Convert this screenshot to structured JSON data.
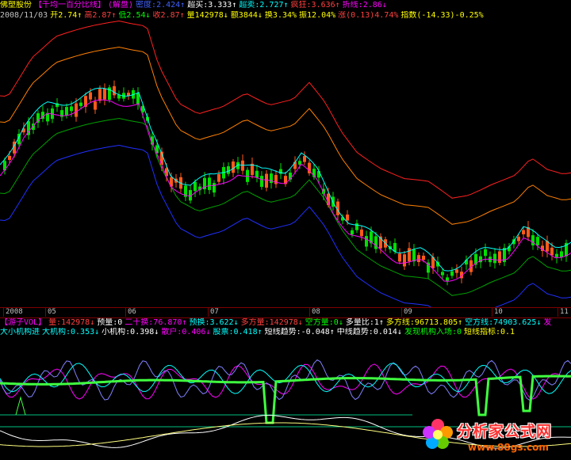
{
  "header1": {
    "items": [
      {
        "text": "佛塑股份",
        "color": "#ffff00"
      },
      {
        "text": "【千均一百分比线】",
        "color": "#ff00ff"
      },
      {
        "text": "(解盘)",
        "color": "#ff00ff"
      },
      {
        "text": "密度:2.424↑",
        "color": "#4060ff"
      },
      {
        "text": "超买:3.333↑",
        "color": "#ffffff"
      },
      {
        "text": "超卖:2.727↑",
        "color": "#00ffff"
      },
      {
        "text": "疯狂:3.636↑",
        "color": "#ff4040"
      },
      {
        "text": "折线:2.86↓",
        "color": "#ff00ff"
      }
    ]
  },
  "header2": {
    "items": [
      {
        "text": "2008/11/03",
        "color": "#c0c0c0"
      },
      {
        "text": "开2.74↑",
        "color": "#ffff00"
      },
      {
        "text": "高2.87↑",
        "color": "#ff4040"
      },
      {
        "text": "低2.54↓",
        "color": "#00ff00"
      },
      {
        "text": "收2.87↑",
        "color": "#ff4040"
      },
      {
        "text": "量142978↓",
        "color": "#ffff00"
      },
      {
        "text": "额3844↓",
        "color": "#ffff00"
      },
      {
        "text": "换3.34%",
        "color": "#ffff00"
      },
      {
        "text": "振12.04%",
        "color": "#ffff00"
      },
      {
        "text": "涨(0.13)4.74%",
        "color": "#ff4040"
      },
      {
        "text": "指数(-14.33)-0.25%",
        "color": "#ffff00"
      }
    ]
  },
  "axis": {
    "labels": [
      "2008",
      "05",
      "06",
      "07",
      "08",
      "09",
      "10",
      "11"
    ]
  },
  "indicator1": {
    "items": [
      {
        "text": "【游子VOL】",
        "color": "#ff00ff"
      },
      {
        "text": "量:142978↓",
        "color": "#ff4040"
      },
      {
        "text": "预量:0",
        "color": "#ffffff"
      },
      {
        "text": "二十换:76.870↑",
        "color": "#ff00ff"
      },
      {
        "text": "预换:3.622↓",
        "color": "#00ffff"
      },
      {
        "text": "多方量:142978↓",
        "color": "#ff4040"
      },
      {
        "text": "空方量:0↓",
        "color": "#00ff00"
      },
      {
        "text": "多量比:1↑",
        "color": "#ffffff"
      },
      {
        "text": "多方线:96713.805↑",
        "color": "#ffff00"
      },
      {
        "text": "空方线:74903.625↓",
        "color": "#00ffff"
      },
      {
        "text": "发",
        "color": "#ff00ff"
      }
    ]
  },
  "indicator2": {
    "items": [
      {
        "text": "大小机构进",
        "color": "#00ffff"
      },
      {
        "text": "大机构:0.353↓",
        "color": "#00ffff"
      },
      {
        "text": "小机构:0.398↓",
        "color": "#ffffff"
      },
      {
        "text": "散户:0.406↓",
        "color": "#ff00ff"
      },
      {
        "text": "股票:0.418↑",
        "color": "#00ffff"
      },
      {
        "text": "短线趋势:-0.048↑",
        "color": "#ffffff"
      },
      {
        "text": "中线趋势:0.014↓",
        "color": "#ffffff"
      },
      {
        "text": "发现机构入场:0",
        "color": "#00ff00"
      },
      {
        "text": "短线指标:0.1",
        "color": "#ffff00"
      }
    ]
  },
  "watermark": {
    "title": "分析家公式网",
    "url": "www.88gs.com"
  },
  "chart_data": {
    "type": "candlestick",
    "x_labels": [
      "2008",
      "05",
      "06",
      "07",
      "08",
      "09",
      "10",
      "11"
    ],
    "last_close": 2.87,
    "last_open": 2.74,
    "last_high": 2.87,
    "last_low": 2.54,
    "last_volume": 142978
  }
}
